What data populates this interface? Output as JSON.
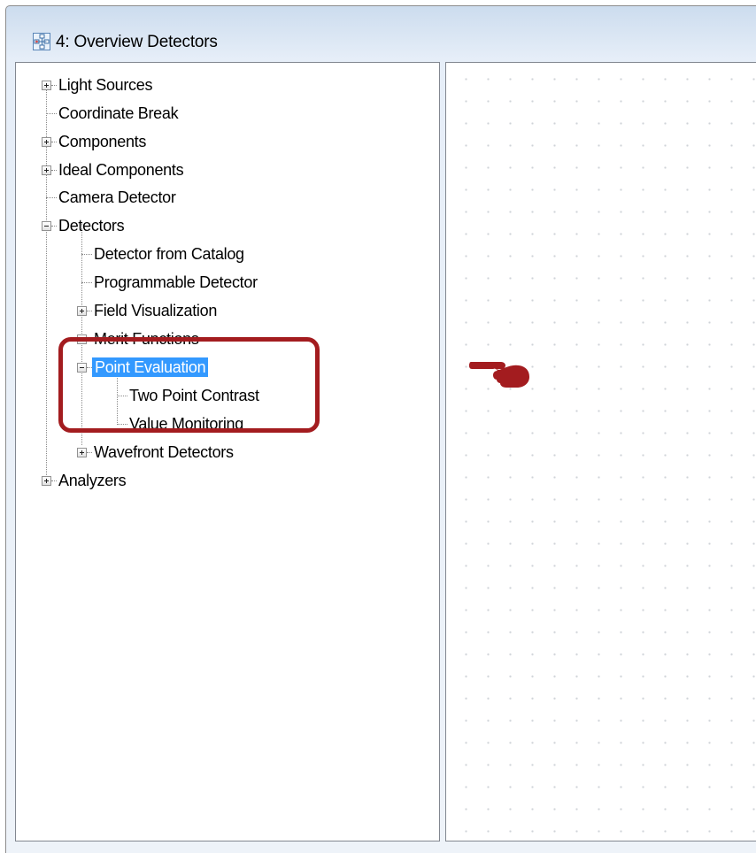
{
  "window": {
    "title": "4: Overview Detectors",
    "icon": "overview-network-icon"
  },
  "tree": {
    "light_sources": "Light Sources",
    "coordinate_break": "Coordinate Break",
    "components": "Components",
    "ideal_components": "Ideal Components",
    "camera_detector": "Camera Detector",
    "detectors": "Detectors",
    "detector_from_catalog": "Detector from Catalog",
    "programmable_detector": "Programmable Detector",
    "field_visualization": "Field Visualization",
    "merit_functions": "Merit Functions",
    "point_evaluation": "Point Evaluation",
    "two_point_contrast": "Two Point Contrast",
    "value_monitoring": "Value Monitoring",
    "wavefront_detectors": "Wavefront Detectors",
    "analyzers": "Analyzers"
  },
  "annotation": {
    "highlight_color": "#a31c1f",
    "pointer_icon": "pointing-hand-icon"
  },
  "colors": {
    "selection": "#3399ff"
  }
}
